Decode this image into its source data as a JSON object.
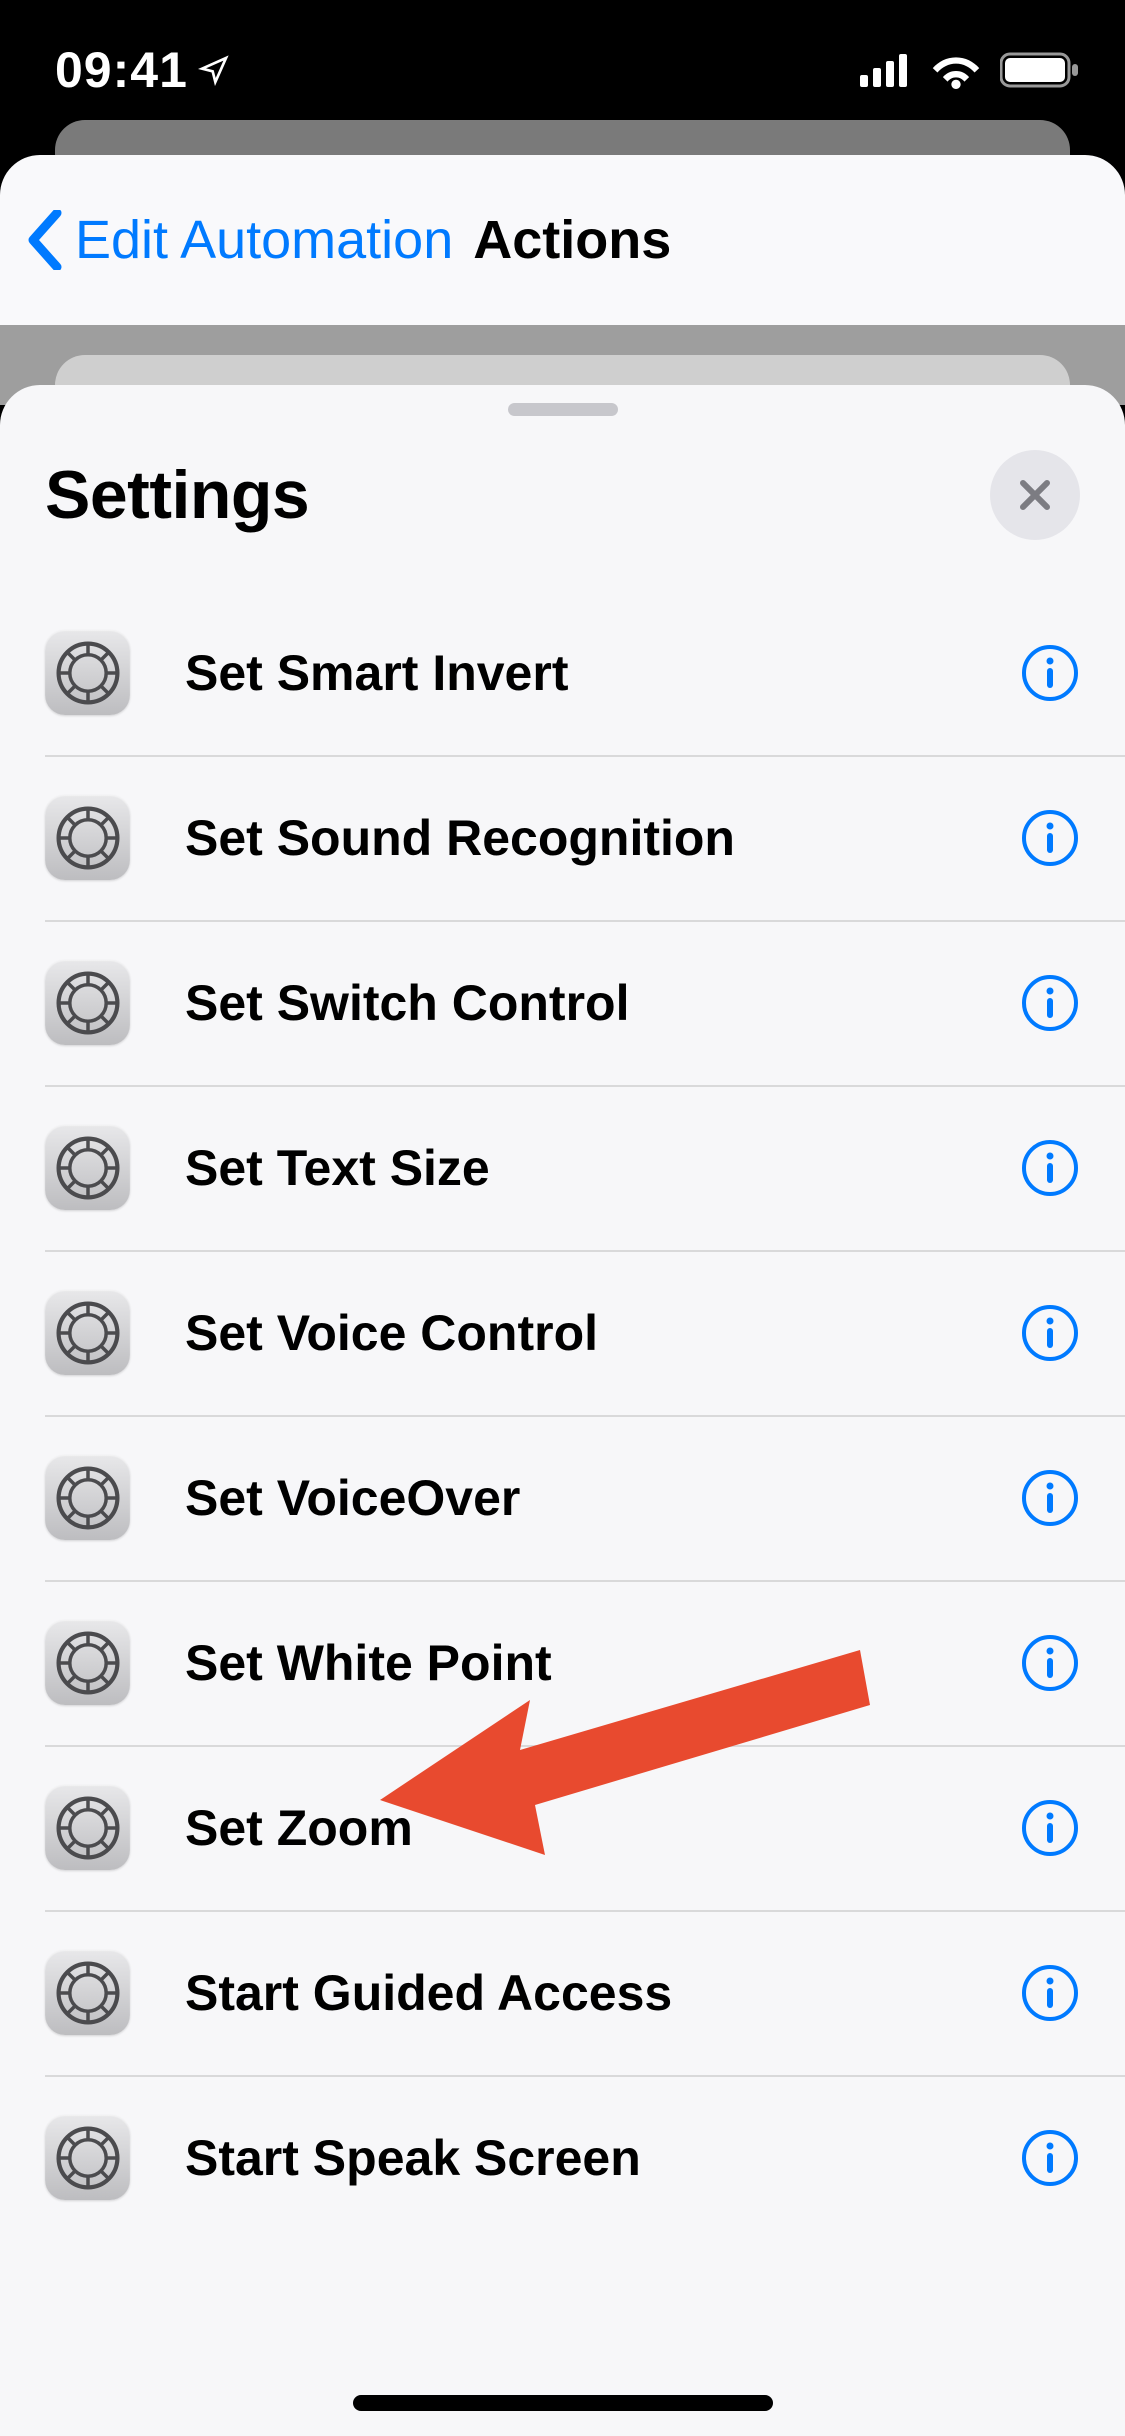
{
  "status_bar": {
    "time": "09:41"
  },
  "nav": {
    "back_label": "Edit Automation",
    "title": "Actions"
  },
  "sheet": {
    "title": "Settings",
    "rows": [
      {
        "label": "Set Smart Invert"
      },
      {
        "label": "Set Sound Recognition"
      },
      {
        "label": "Set Switch Control"
      },
      {
        "label": "Set Text Size"
      },
      {
        "label": "Set Voice Control"
      },
      {
        "label": "Set VoiceOver"
      },
      {
        "label": "Set White Point"
      },
      {
        "label": "Set Zoom"
      },
      {
        "label": "Start Guided Access"
      },
      {
        "label": "Start Speak Screen"
      }
    ]
  }
}
